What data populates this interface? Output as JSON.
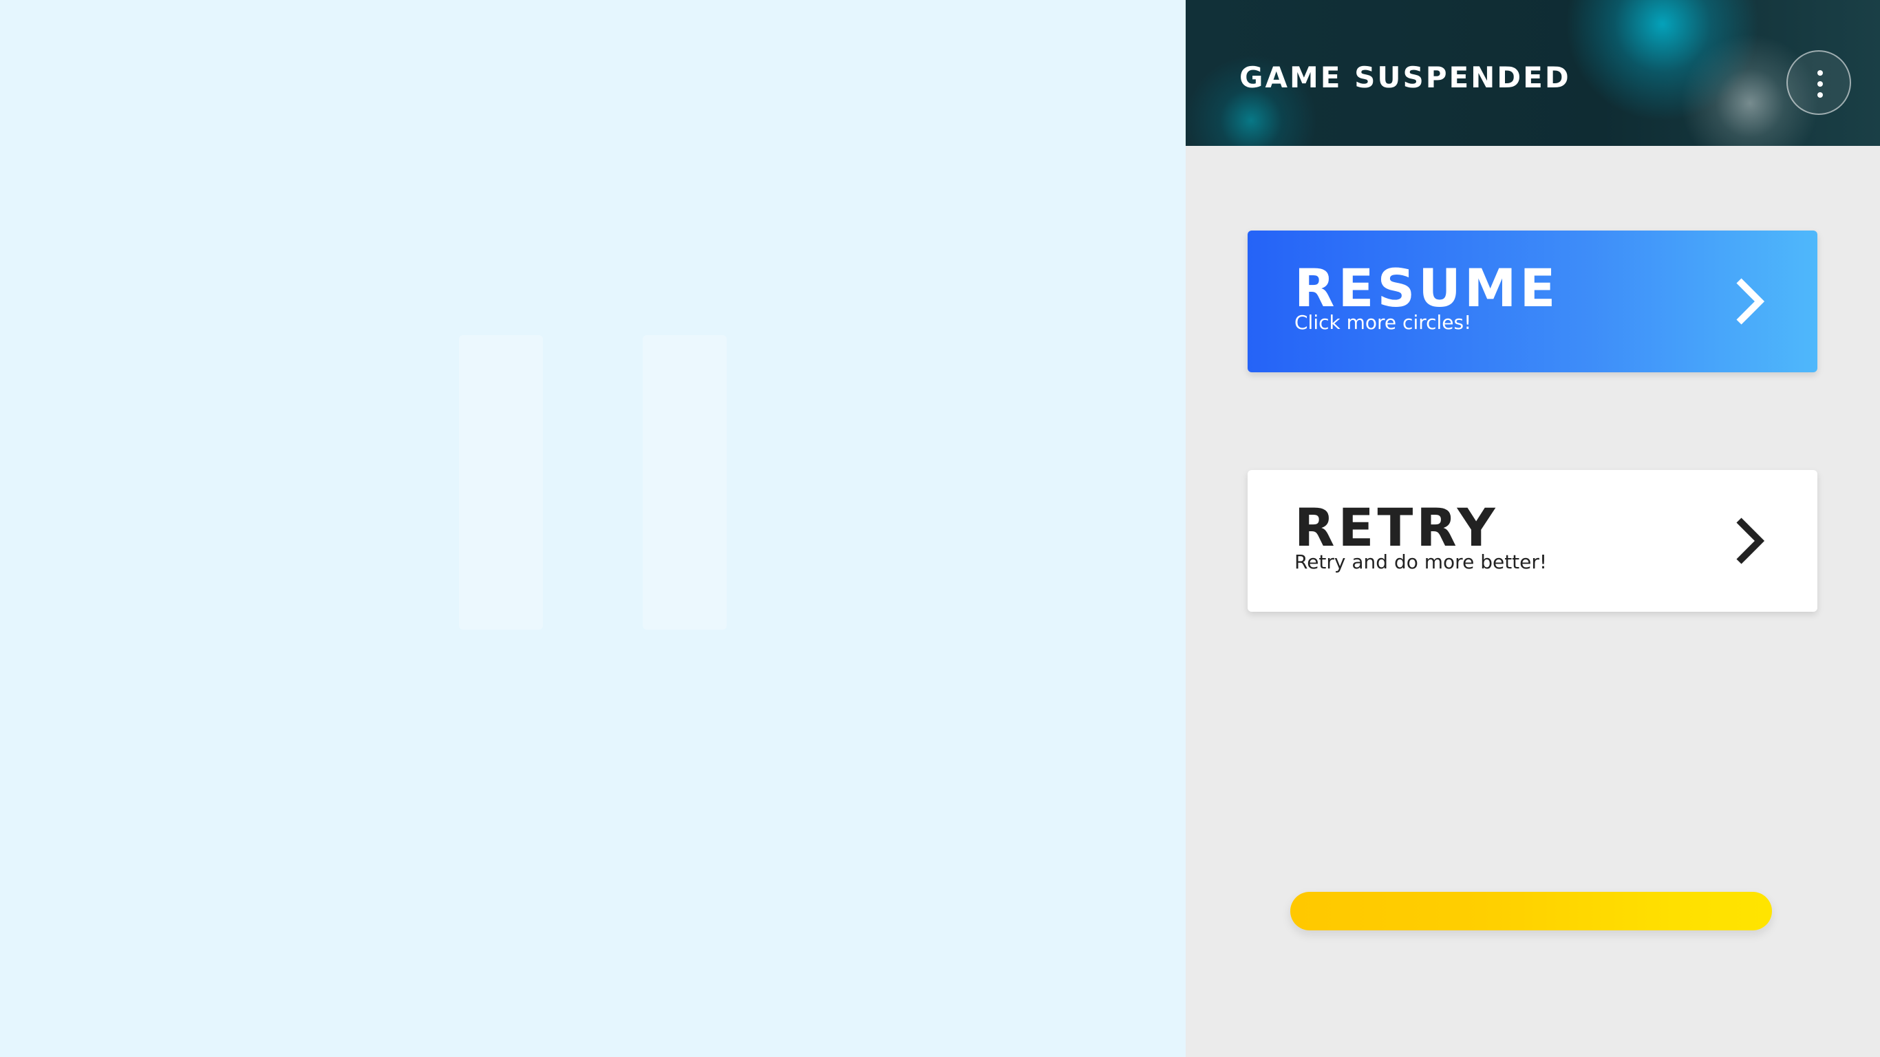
{
  "panel": {
    "title": "GAME SUSPENDED",
    "menu_icon": "vertical-dots-icon"
  },
  "cards": {
    "resume": {
      "title": "RESUME",
      "subtitle": "Click more circles!",
      "icon": "chevron-right-icon"
    },
    "retry": {
      "title": "RETRY",
      "subtitle": "Retry and do more better!",
      "icon": "chevron-right-icon"
    }
  },
  "background": {
    "icon": "pause-icon"
  },
  "colors": {
    "stage_background": "#e5f6fe",
    "panel_background": "#ebebeb",
    "resume_gradient_start": "#2563f7",
    "resume_gradient_end": "#4fb8fb",
    "retry_background": "#ffffff",
    "progress_yellow": "#ffd400"
  }
}
